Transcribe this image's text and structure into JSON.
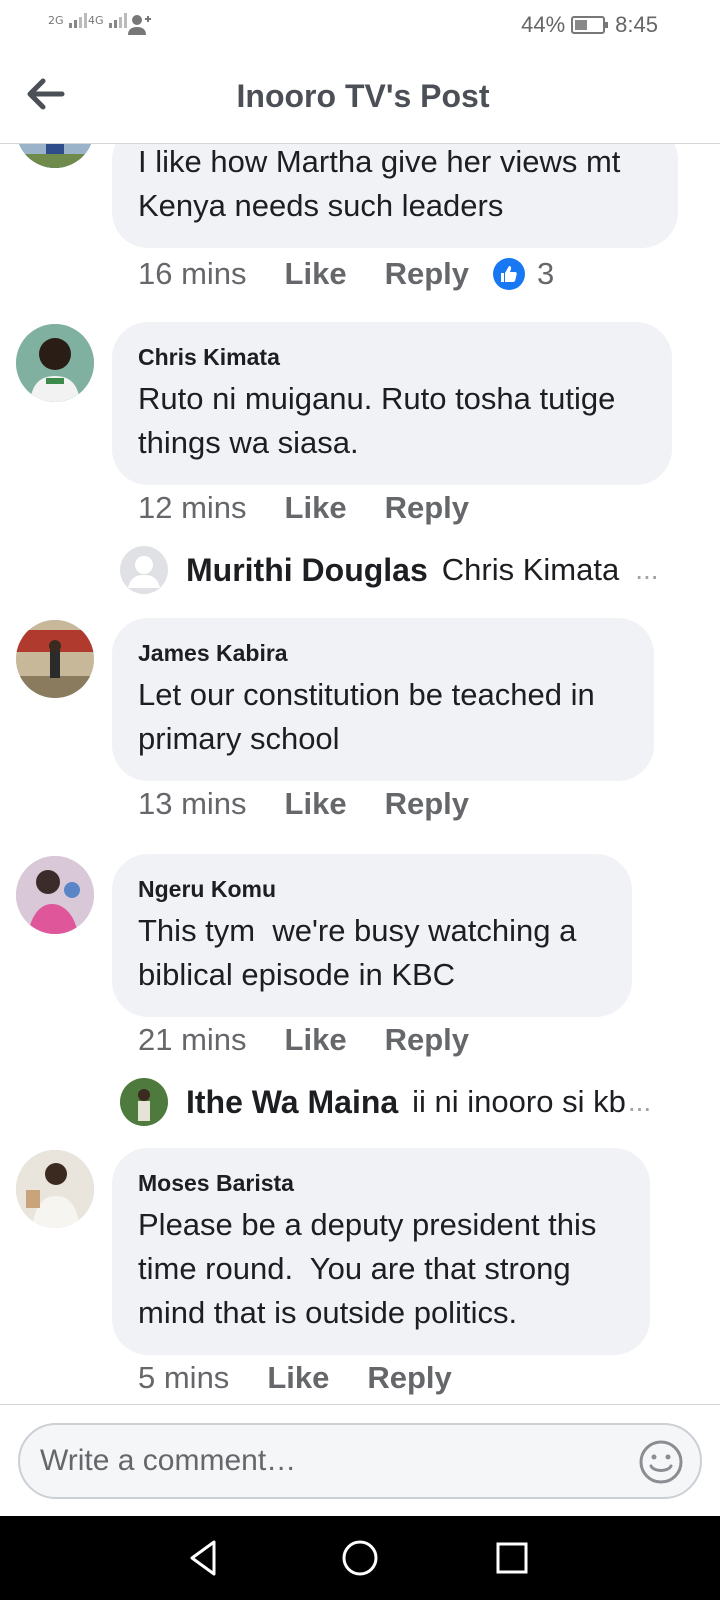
{
  "status_bar": {
    "signal_1": "2G",
    "signal_2": "4G",
    "battery_percent": "44%",
    "battery_level": 0.44,
    "time": "8:45"
  },
  "header": {
    "title": "Inooro TV's Post"
  },
  "comments": [
    {
      "author": "",
      "text": "I like how Martha give her views mt Kenya needs such leaders",
      "time": "16 mins",
      "like_label": "Like",
      "reply_label": "Reply",
      "reaction_count": "3"
    },
    {
      "author": "Chris Kimata",
      "text": "Ruto ni muiganu. Ruto tosha tutige things wa siasa.",
      "time": "12 mins",
      "like_label": "Like",
      "reply_label": "Reply",
      "reply_preview": {
        "name": "Murithi Douglas",
        "text": "Chris Kimata",
        "more": "..."
      }
    },
    {
      "author": "James Kabira",
      "text": "Let our constitution be teached in primary school",
      "time": "13 mins",
      "like_label": "Like",
      "reply_label": "Reply"
    },
    {
      "author": "Ngeru Komu",
      "text": "This tym  we're busy watching a biblical episode in KBC",
      "time": "21 mins",
      "like_label": "Like",
      "reply_label": "Reply",
      "reply_preview": {
        "name": "Ithe Wa Maina",
        "text": "ii ni inooro si kb",
        "more": "..."
      }
    },
    {
      "author": "Moses Barista",
      "text": "Please be a deputy president this time round.  You are that strong mind that is outside politics.",
      "time": "5 mins",
      "like_label": "Like",
      "reply_label": "Reply"
    }
  ],
  "composer": {
    "placeholder": "Write a comment…"
  },
  "icons": {
    "back": "back-arrow-icon",
    "like_reaction": "thumbs-up-icon",
    "emoji": "smiley-face-icon",
    "nav_back": "triangle-back-icon",
    "nav_home": "circle-home-icon",
    "nav_recents": "square-recents-icon"
  },
  "colors": {
    "bubble": "#f0f2f5",
    "text_secondary": "#65676b",
    "like_blue": "#1877f2"
  }
}
